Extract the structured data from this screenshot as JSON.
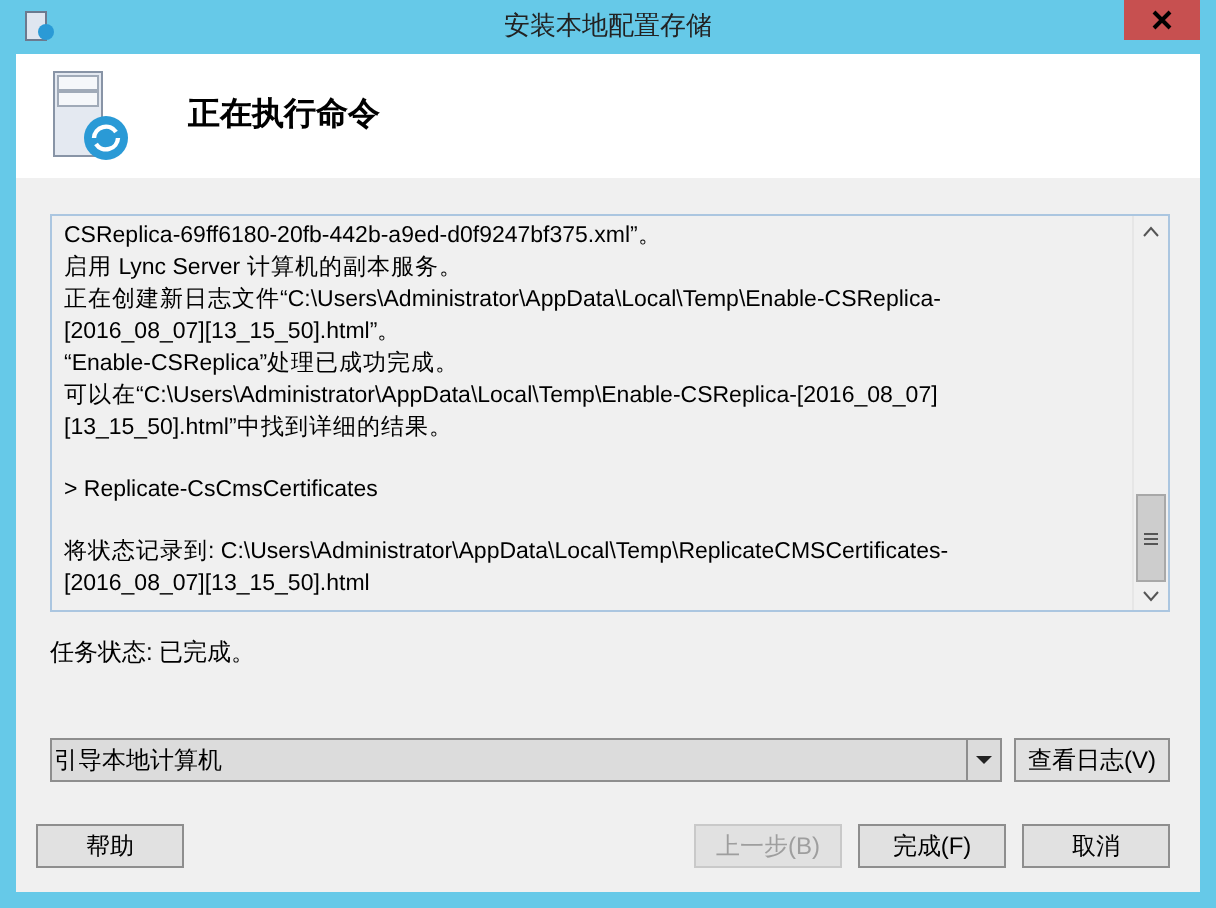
{
  "window": {
    "title": "安装本地配置存储"
  },
  "header": {
    "title": "正在执行命令"
  },
  "log": [
    [
      "CSReplica-69ff6180-20fb-442b-a9ed-d0f9247bf375.xml”。",
      "启用 Lync Server 计算机的副本服务。",
      "正在创建新日志文件“C:\\Users\\Administrator\\AppData\\Local\\Temp\\Enable-CSReplica-",
      "[2016_08_07][13_15_50].html”。",
      "“Enable-CSReplica”处理已成功完成。",
      "可以在“C:\\Users\\Administrator\\AppData\\Local\\Temp\\Enable-CSReplica-[2016_08_07]",
      "[13_15_50].html”中找到详细的结果。"
    ],
    [
      "> Replicate-CsCmsCertificates"
    ],
    [
      "将状态记录到: C:\\Users\\Administrator\\AppData\\Local\\Temp\\ReplicateCMSCertificates-",
      "[2016_08_07][13_15_50].html"
    ]
  ],
  "task_status": "任务状态: 已完成。",
  "combo": {
    "value": "引导本地计算机"
  },
  "view_log_button": {
    "label": "查看日志(V)",
    "disabled": false
  },
  "left_buttons": [
    {
      "label": "帮助",
      "disabled": false
    }
  ],
  "right_buttons": [
    {
      "label": "上一步(B)",
      "disabled": true
    },
    {
      "label": "完成(F)",
      "disabled": false
    },
    {
      "label": "取消",
      "disabled": false
    }
  ]
}
